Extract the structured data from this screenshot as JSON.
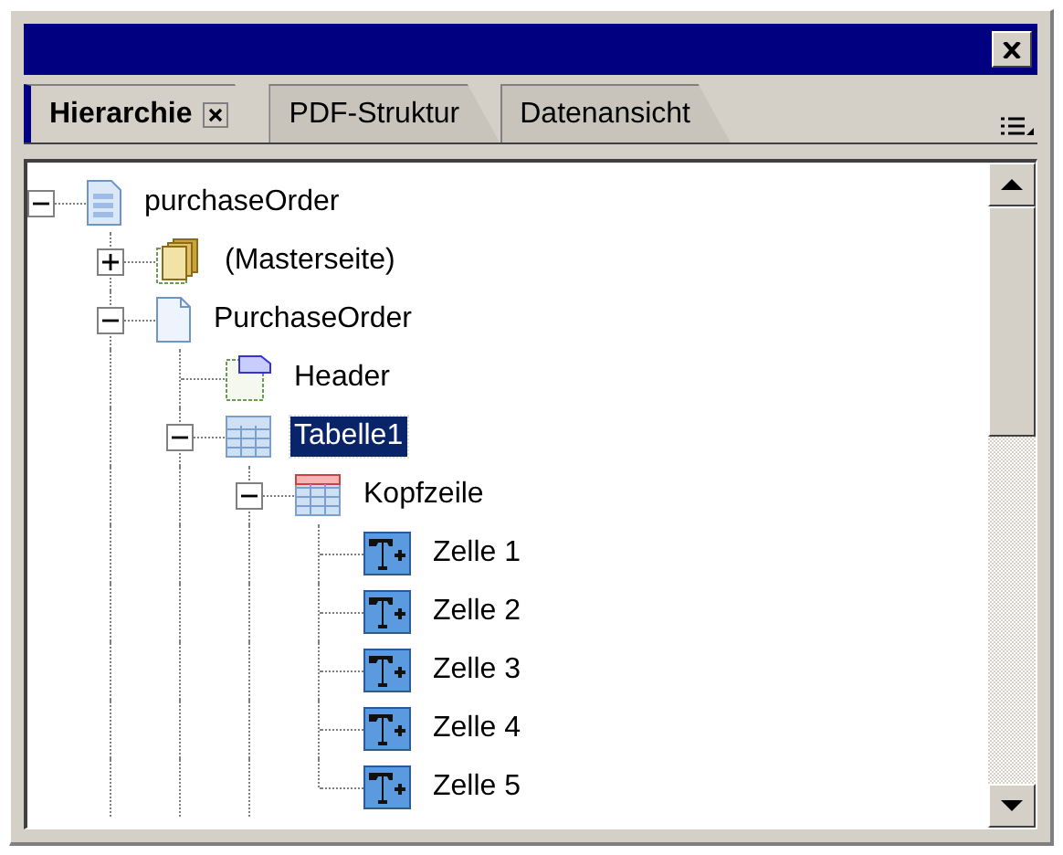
{
  "tabs": [
    {
      "label": "Hierarchie",
      "selected": true,
      "closable": true
    },
    {
      "label": "PDF-Struktur",
      "selected": false,
      "closable": false
    },
    {
      "label": "Datenansicht",
      "selected": false,
      "closable": false
    }
  ],
  "tree": [
    {
      "label": "purchaseOrder",
      "kind": "document",
      "expanded": true,
      "selected": false,
      "children": [
        {
          "label": "(Masterseite)",
          "kind": "masterpages",
          "expanded": false,
          "selected": false
        },
        {
          "label": "PurchaseOrder",
          "kind": "page",
          "expanded": true,
          "selected": false,
          "children": [
            {
              "label": "Header",
              "kind": "header",
              "selected": false
            },
            {
              "label": "Tabelle1",
              "kind": "table",
              "expanded": true,
              "selected": true,
              "children": [
                {
                  "label": "Kopfzeile",
                  "kind": "headrow",
                  "expanded": true,
                  "selected": false,
                  "children": [
                    {
                      "label": "Zelle 1",
                      "kind": "textcell",
                      "selected": false
                    },
                    {
                      "label": "Zelle 2",
                      "kind": "textcell",
                      "selected": false
                    },
                    {
                      "label": "Zelle 3",
                      "kind": "textcell",
                      "selected": false
                    },
                    {
                      "label": "Zelle 4",
                      "kind": "textcell",
                      "selected": false
                    },
                    {
                      "label": "Zelle 5",
                      "kind": "textcell",
                      "selected": false
                    }
                  ]
                }
              ]
            }
          ]
        }
      ]
    }
  ]
}
